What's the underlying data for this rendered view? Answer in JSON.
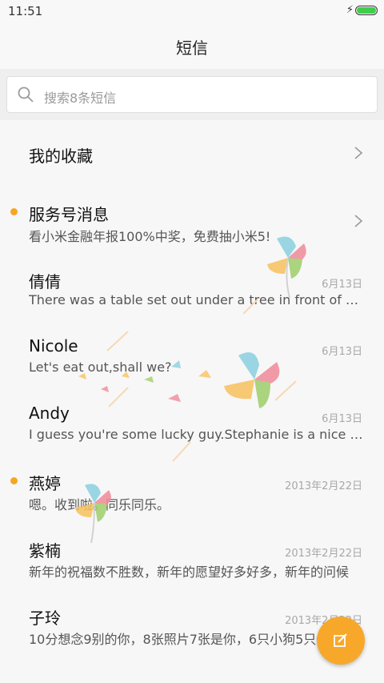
{
  "status_bar": {
    "time": "11:51",
    "battery_color": "#3ecf4a"
  },
  "header": {
    "title": "短信"
  },
  "search": {
    "placeholder": "搜索8条短信"
  },
  "favorites": {
    "label": "我的收藏"
  },
  "conversations": [
    {
      "name": "服务号消息",
      "preview": "看小米金融年报100%中奖，免费抽小米5!",
      "date": "",
      "unread": true,
      "has_chevron": true
    },
    {
      "name": "倩倩",
      "preview": "There was a table set out under a tree in front of the house, and the March Hare and the Hatter were having tea at it",
      "date": "6月13日",
      "unread": false
    },
    {
      "name": "Nicole",
      "preview": "Let's eat out,shall we?",
      "date": "6月13日",
      "unread": false
    },
    {
      "name": "Andy",
      "preview": "I guess you're some lucky guy.Stephanie is a nice girl.",
      "date": "6月13日",
      "unread": false
    },
    {
      "name": "燕婷",
      "preview": "嗯。收到啦。同乐同乐。",
      "date": "2013年2月22日",
      "unread": true
    },
    {
      "name": "紫楠",
      "preview": "新年的祝福数不胜数，新年的愿望好多好多，新年的问候",
      "date": "2013年2月22日",
      "unread": false
    },
    {
      "name": "子玲",
      "preview": "10分想念9别的你，8张照片7张是你，6只小狗5只像你",
      "date": "2013年2月22日",
      "unread": false
    }
  ],
  "colors": {
    "accent": "#f5a623",
    "fab": "#f7a82a"
  },
  "icons": {
    "search": "search-icon",
    "chevron": "chevron-right-icon",
    "compose": "compose-icon"
  }
}
